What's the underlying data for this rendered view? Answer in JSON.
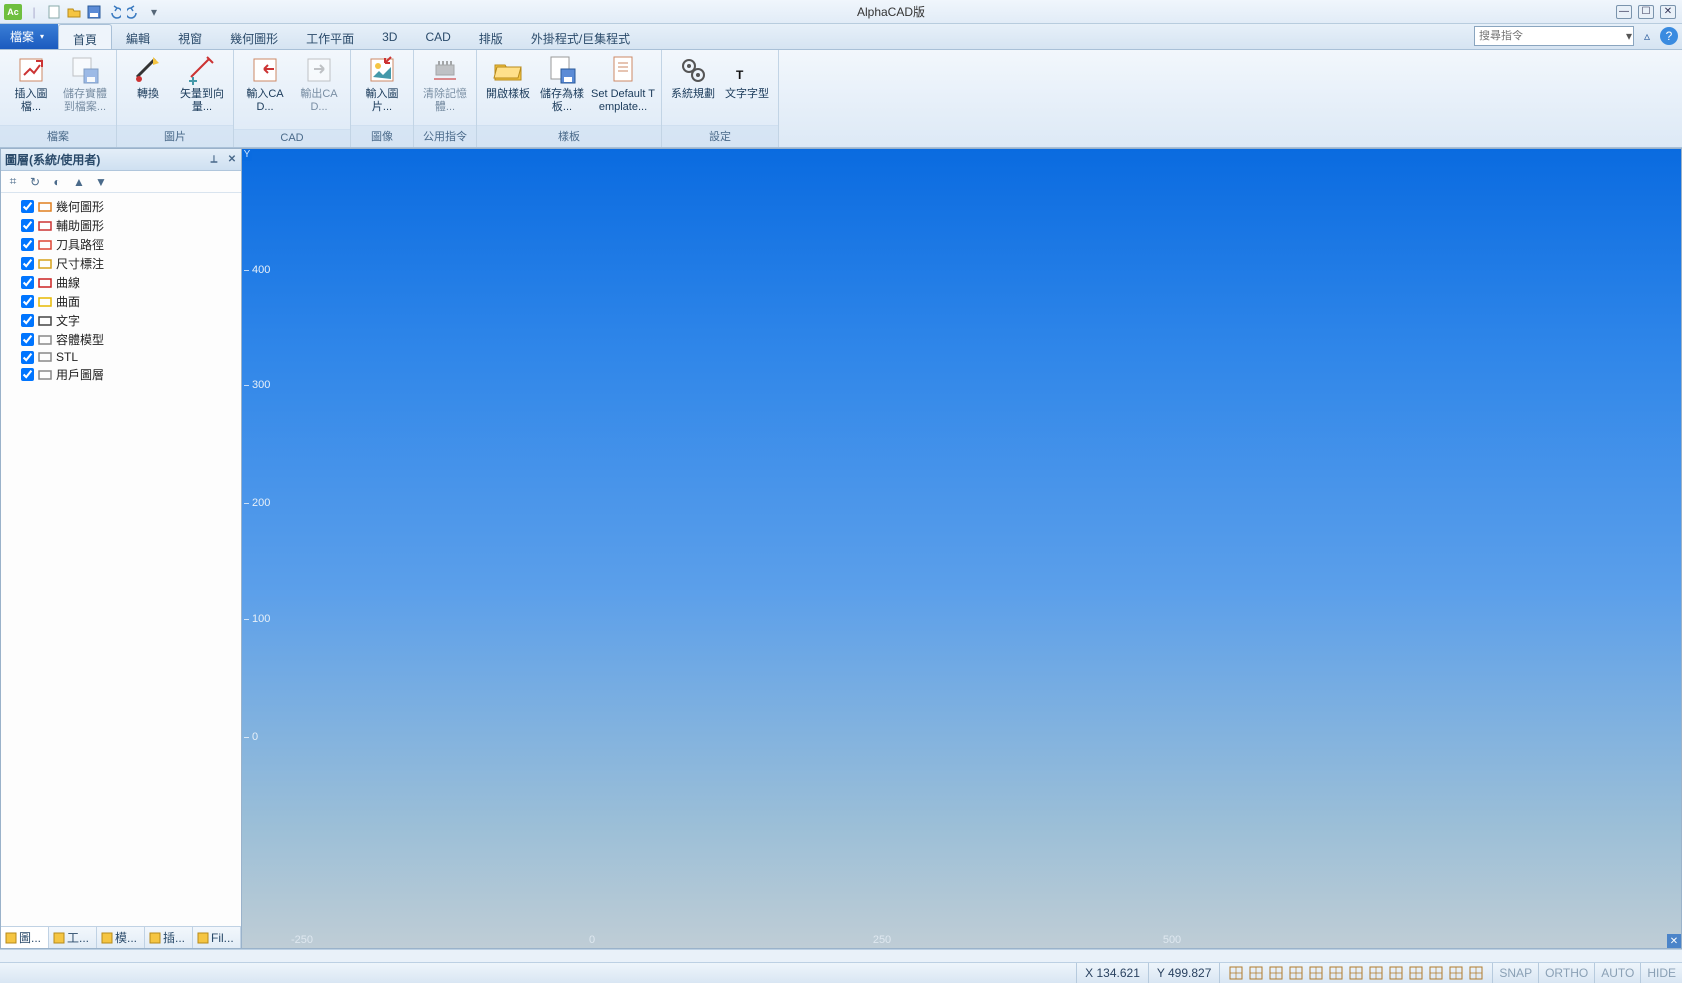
{
  "app": {
    "title": "AlphaCAD版"
  },
  "qat_icons": [
    "app-icon",
    "new-file-icon",
    "open-folder-icon",
    "save-icon",
    "undo-icon",
    "redo-icon",
    "customize-icon"
  ],
  "file_menu_label": "檔案",
  "tabs": [
    "首頁",
    "編輯",
    "視窗",
    "幾何圖形",
    "工作平面",
    "3D",
    "CAD",
    "排版",
    "外掛程式/巨集程式"
  ],
  "active_tab_index": 0,
  "search_placeholder": "搜尋指令",
  "ribbon_groups": [
    {
      "label": "檔案",
      "items": [
        {
          "label": "插入圖檔...",
          "icon": "insert-drawing-icon"
        },
        {
          "label": "儲存實體到檔案...",
          "icon": "save-entity-icon",
          "disabled": true
        }
      ]
    },
    {
      "label": "圖片",
      "items": [
        {
          "label": "轉換",
          "icon": "convert-icon"
        },
        {
          "label": "矢量到向量...",
          "icon": "vectorize-icon"
        }
      ]
    },
    {
      "label": "CAD",
      "items": [
        {
          "label": "輸入CAD...",
          "icon": "import-cad-icon"
        },
        {
          "label": "輸出CAD...",
          "icon": "export-cad-icon",
          "disabled": true
        }
      ]
    },
    {
      "label": "圖像",
      "items": [
        {
          "label": "輸入圖片...",
          "icon": "import-image-icon"
        }
      ]
    },
    {
      "label": "公用指令",
      "items": [
        {
          "label": "清除記憶體...",
          "icon": "clear-memory-icon",
          "disabled": true
        }
      ]
    },
    {
      "label": "樣板",
      "items": [
        {
          "label": "開啟樣板",
          "icon": "open-template-icon"
        },
        {
          "label": "儲存為樣板...",
          "icon": "save-template-icon"
        },
        {
          "label": "Set Default Template...",
          "icon": "default-template-icon",
          "wide": true
        }
      ]
    },
    {
      "label": "設定",
      "items": [
        {
          "label": "系統規劃",
          "icon": "gears-icon"
        },
        {
          "label": "文字字型",
          "icon": "text-font-icon"
        }
      ]
    }
  ],
  "side": {
    "title": "圖層(系統/使用者)",
    "toolbar_icons": [
      "tree-icon",
      "refresh-icon",
      "toggle-icon",
      "up-icon",
      "down-icon"
    ],
    "layers": [
      {
        "label": "幾何圖形",
        "color": "#e07f1f"
      },
      {
        "label": "輔助圖形",
        "color": "#c33"
      },
      {
        "label": "刀具路徑",
        "color": "#d43"
      },
      {
        "label": "尺寸標注",
        "color": "#d6a21a"
      },
      {
        "label": "曲線",
        "color": "#c22"
      },
      {
        "label": "曲面",
        "color": "#e6b800"
      },
      {
        "label": "文字",
        "color": "#444"
      },
      {
        "label": "容體模型",
        "color": "#888"
      },
      {
        "label": "STL",
        "color": "#888"
      },
      {
        "label": "用戶圖層",
        "color": "#888"
      }
    ],
    "tabs": [
      {
        "label": "圖...",
        "icon": "layers-tab-icon"
      },
      {
        "label": "工...",
        "icon": "tools-tab-icon"
      },
      {
        "label": "模...",
        "icon": "model-tab-icon"
      },
      {
        "label": "插...",
        "icon": "insert-tab-icon"
      },
      {
        "label": "Fil...",
        "icon": "file-tab-icon"
      }
    ],
    "active_tab_index": 0
  },
  "canvas": {
    "y_ticks": [
      "400",
      "300",
      "200",
      "100",
      "0"
    ],
    "x_ticks": [
      "-250",
      "0",
      "250",
      "500"
    ],
    "axis_y_label": "Y"
  },
  "status": {
    "coord_x": "X 134.621",
    "coord_y": "Y 499.827",
    "view_icons": [
      "home-view-icon",
      "grid-icon",
      "axes-icon",
      "rotate-icon",
      "plane-icon",
      "front-icon",
      "top-icon",
      "right-icon",
      "left-icon",
      "iso1-icon",
      "iso2-icon",
      "iso3-icon",
      "iso4-icon"
    ],
    "toggles": [
      "SNAP",
      "ORTHO",
      "AUTO",
      "HIDE"
    ]
  }
}
